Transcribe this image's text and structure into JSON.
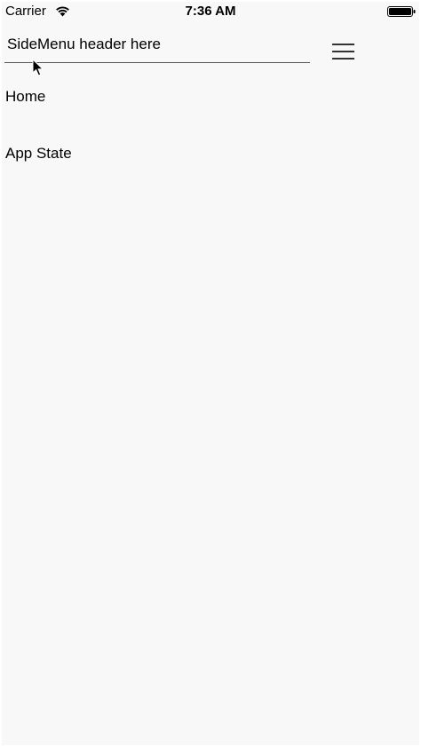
{
  "status_bar": {
    "carrier": "Carrier",
    "time": "7:36 AM",
    "icons": [
      "wifi-icon",
      "battery-icon"
    ]
  },
  "header": {
    "title": "SideMenu header here",
    "menu_icon": "hamburger-menu-icon"
  },
  "menu": {
    "items": [
      {
        "label": "Home"
      },
      {
        "label": "App State"
      }
    ]
  },
  "colors": {
    "background": "#f8f8f8",
    "text": "#000000",
    "divider": "#555555"
  }
}
